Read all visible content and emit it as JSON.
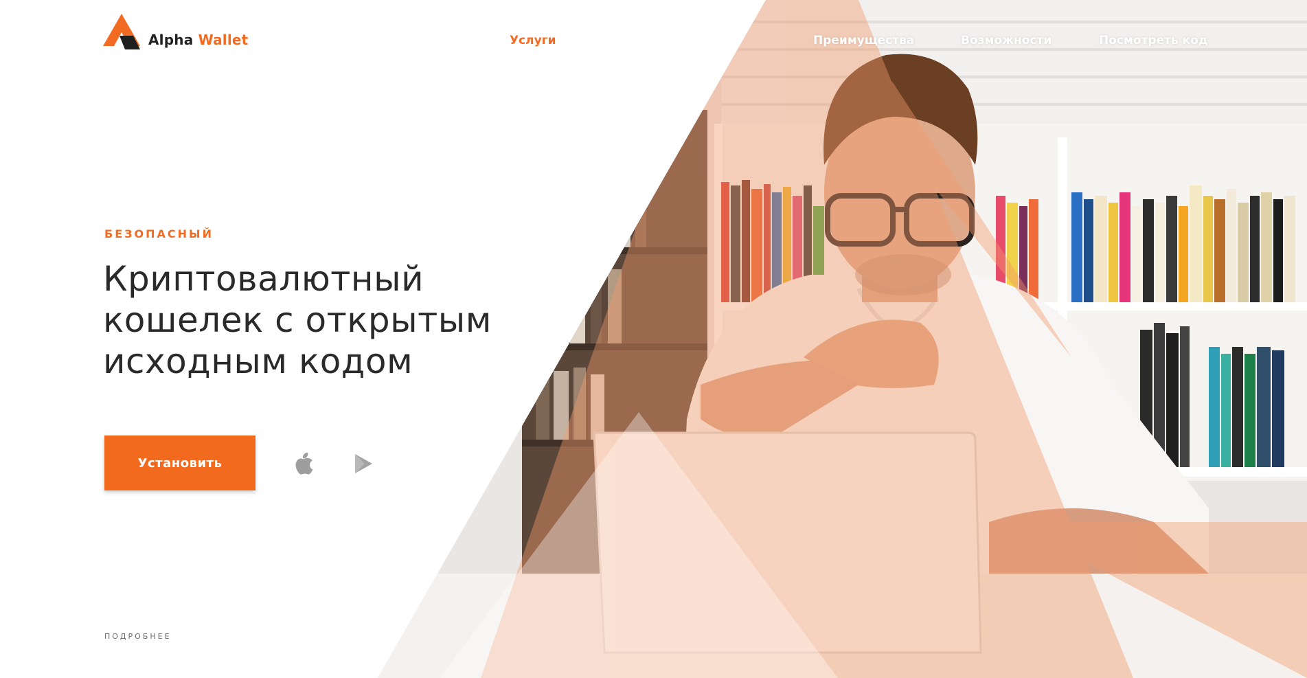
{
  "brand": {
    "name_part1": "Alpha",
    "name_part2": "Wallet",
    "logo_icon": "alpha-triangle-logo-icon",
    "accent_color": "#f26b22"
  },
  "nav": {
    "items": [
      {
        "label": "Услуги",
        "active": true
      },
      {
        "label": "Преимущества",
        "active": false
      },
      {
        "label": "Возможности",
        "active": false
      },
      {
        "label": "Посмотреть код",
        "active": false
      }
    ]
  },
  "hero": {
    "eyebrow": "БЕЗОПАСНЫЙ",
    "headline_lines": [
      "Криптовалютный",
      "кошелек с открытым",
      "исходным кодом"
    ],
    "install_button": "Установить",
    "store_icons": [
      "apple-icon",
      "google-play-icon"
    ],
    "more_link": "ПОДРОБНЕЕ",
    "photo_subject": "man-with-laptop-photo"
  },
  "colors": {
    "accent": "#f26b22",
    "button": "#f26a1e",
    "headline": "#2a2a2a",
    "overlay_triangles": "#f6c8b0"
  }
}
